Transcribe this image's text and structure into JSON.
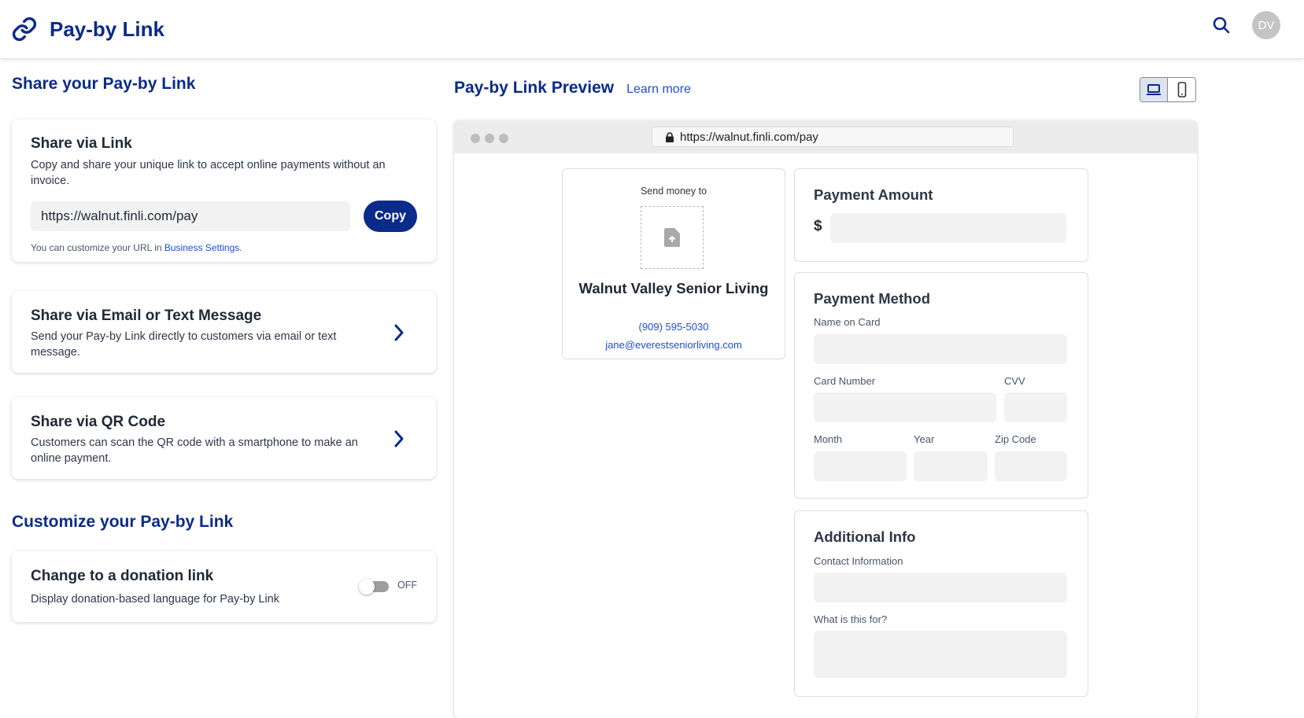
{
  "header": {
    "title": "Pay-by Link",
    "avatar_initials": "DV"
  },
  "share": {
    "section_title": "Share your Pay-by Link",
    "link_card": {
      "title": "Share via Link",
      "description": "Copy and share your unique link to accept online payments without an invoice.",
      "url_value": "https://walnut.finli.com/pay",
      "copy_label": "Copy",
      "note_prefix": "You can customize your URL in ",
      "note_link": "Business Settings",
      "note_suffix": "."
    },
    "email_card": {
      "title": "Share via Email or Text Message",
      "description": "Send your Pay-by Link directly to customers via email or text message."
    },
    "qr_card": {
      "title": "Share via QR Code",
      "description": "Customers can scan the QR code with a smartphone to make an online payment."
    }
  },
  "customize": {
    "section_title": "Customize your Pay-by Link",
    "donation_card": {
      "title": "Change to a donation link",
      "description": "Display donation-based language for Pay-by Link",
      "toggle_state": "OFF"
    }
  },
  "preview": {
    "title": "Pay-by Link Preview",
    "learn_more": "Learn more",
    "url": "https://walnut.finli.com/pay",
    "merchant": {
      "send_money_to": "Send money to",
      "name": "Walnut Valley Senior Living",
      "phone": "(909) 595-5030",
      "email": "jane@everestseniorliving.com"
    },
    "payment_amount": {
      "title": "Payment Amount",
      "currency_symbol": "$"
    },
    "payment_method": {
      "title": "Payment Method",
      "name_on_card": "Name on Card",
      "card_number": "Card Number",
      "cvv": "CVV",
      "month": "Month",
      "year": "Year",
      "zip_code": "Zip Code"
    },
    "additional_info": {
      "title": "Additional Info",
      "contact_information": "Contact Information",
      "what_is_this_for": "What is this for?"
    }
  },
  "colors": {
    "brand_navy": "#0b2a8a",
    "link_blue": "#1d4ed8"
  }
}
